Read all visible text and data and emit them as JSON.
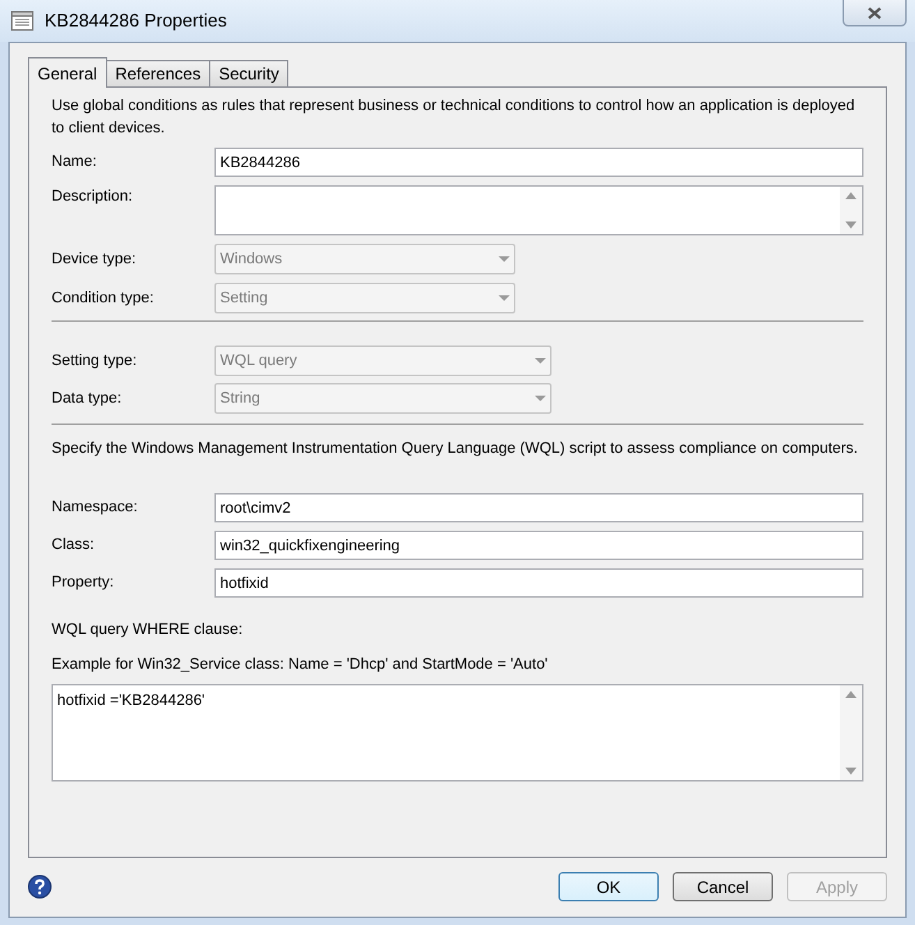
{
  "window": {
    "title": "KB2844286 Properties"
  },
  "tabs": [
    {
      "label": "General",
      "selected": true
    },
    {
      "label": "References",
      "selected": false
    },
    {
      "label": "Security",
      "selected": false
    }
  ],
  "intro": "Use global conditions as rules that represent business or technical conditions to control how an application is deployed to client devices.",
  "general_fields": [
    {
      "kind": "text",
      "label": "Name:",
      "value": "KB2844286"
    },
    {
      "kind": "textarea",
      "label": "Description:"
    },
    {
      "kind": "dropdown",
      "label": "Device type:",
      "value": "Windows",
      "disabled": true
    },
    {
      "kind": "dropdown",
      "label": "Condition type:",
      "value": "Setting",
      "disabled": true
    }
  ],
  "setting_fields": [
    {
      "kind": "dropdown",
      "label": "Setting type:",
      "value": "WQL query",
      "disabled": true
    },
    {
      "kind": "dropdown",
      "label": "Data type:",
      "value": "String",
      "disabled": true
    }
  ],
  "wql_intro": "Specify the Windows Management Instrumentation Query Language (WQL) script to assess compliance on computers.",
  "wmi_fields": [
    {
      "kind": "text",
      "label": "Namespace:",
      "value": "root\\cimv2"
    },
    {
      "kind": "text",
      "label": "Class:",
      "value": "win32_quickfixengineering"
    },
    {
      "kind": "text",
      "label": "Property:",
      "value": "hotfixid"
    }
  ],
  "where_label": "WQL query WHERE clause:",
  "where_example": "Example for Win32_Service class: Name = 'Dhcp' and StartMode = 'Auto'",
  "where_clause": "hotfixid ='KB2844286'",
  "buttons": [
    {
      "label": "OK",
      "default": true,
      "disabled": false
    },
    {
      "label": "Cancel",
      "default": false,
      "disabled": false
    },
    {
      "label": "Apply",
      "default": false,
      "disabled": true
    }
  ]
}
